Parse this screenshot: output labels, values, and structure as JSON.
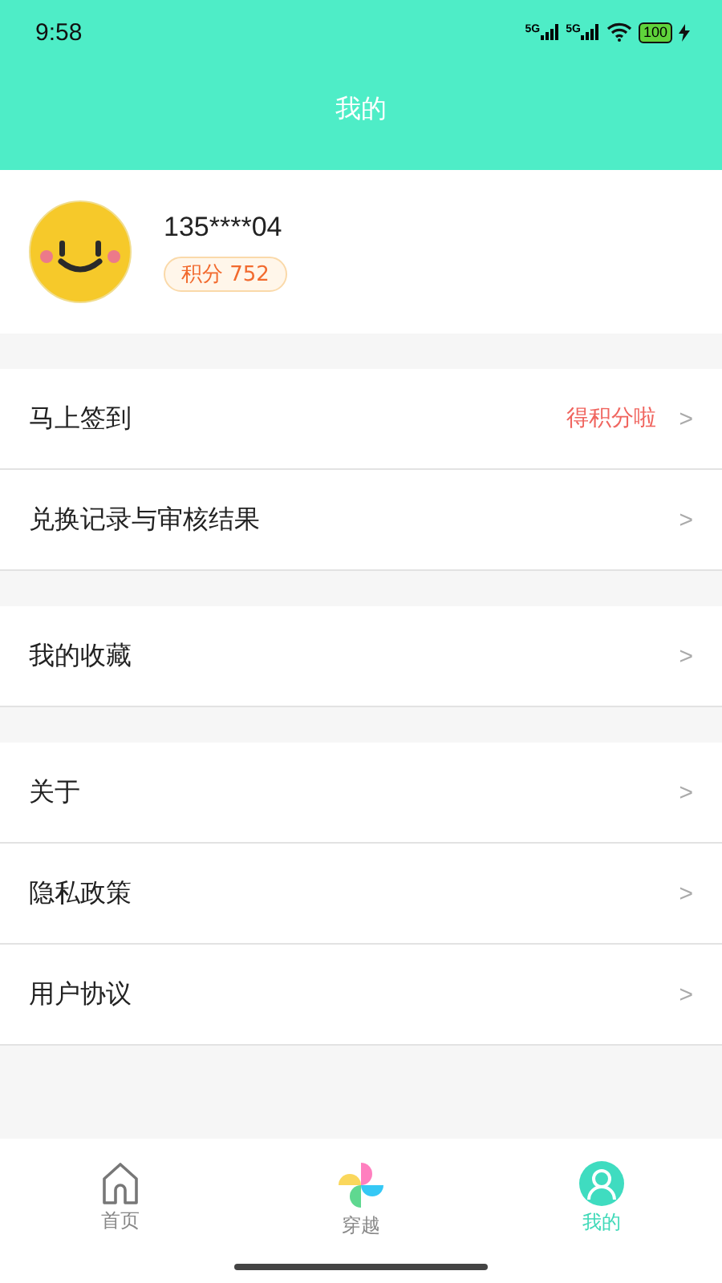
{
  "status_bar": {
    "time": "9:58",
    "networks": [
      "5G",
      "5G"
    ],
    "battery": "100"
  },
  "header": {
    "title": "我的"
  },
  "profile": {
    "phone": "135****04",
    "points_label": "积分 752"
  },
  "groups": [
    {
      "items": [
        {
          "label": "马上签到",
          "hint": "得积分啦",
          "chevron": ">"
        },
        {
          "label": "兑换记录与审核结果",
          "chevron": ">"
        }
      ]
    },
    {
      "items": [
        {
          "label": "我的收藏",
          "chevron": ">"
        }
      ]
    },
    {
      "items": [
        {
          "label": "关于",
          "chevron": ">"
        },
        {
          "label": "隐私政策",
          "chevron": ">"
        },
        {
          "label": "用户协议",
          "chevron": ">"
        }
      ]
    }
  ],
  "tabs": [
    {
      "label": "首页",
      "kind": "home",
      "selected": false
    },
    {
      "label": "穿越",
      "kind": "pinwheel",
      "selected": false
    },
    {
      "label": "我的",
      "kind": "user",
      "selected": true
    }
  ]
}
